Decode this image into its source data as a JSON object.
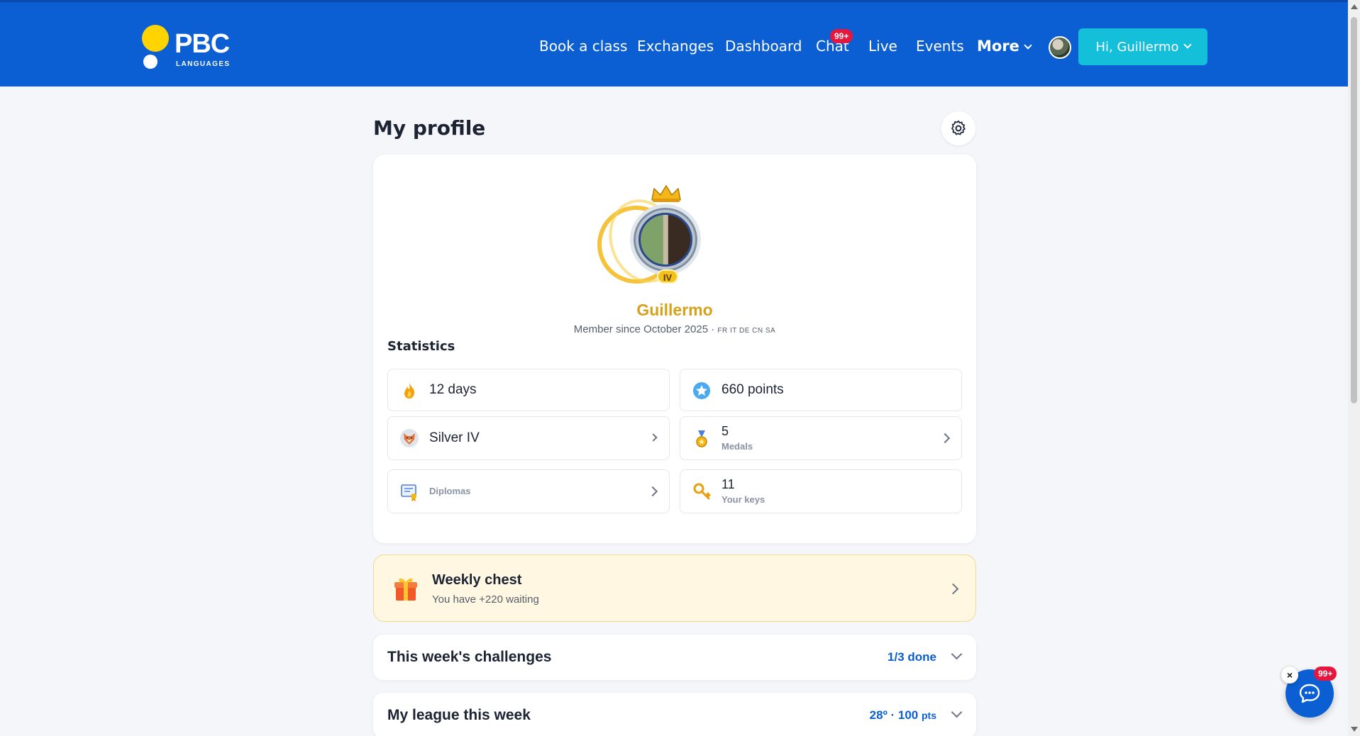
{
  "brand": {
    "name": "PBC",
    "subtitle": "LANGUAGES"
  },
  "nav": {
    "book": "Book a class",
    "exchanges": "Exchanges",
    "dashboard": "Dashboard",
    "chat": "Chat",
    "chat_badge": "99+",
    "live": "Live",
    "events": "Events",
    "more": "More"
  },
  "user_menu": {
    "label": "Hi, Guillermo"
  },
  "page": {
    "title": "My profile"
  },
  "profile": {
    "tier_badge": "IV",
    "name": "Guillermo",
    "member_since": "Member since October 2025 ·",
    "languages": "FR IT DE CN SA"
  },
  "stats": {
    "heading": "Statistics",
    "streak": "12 days",
    "points": "660 points",
    "league": "Silver IV",
    "medals_value": "5",
    "medals_label": "Medals",
    "diplomas_label": "Diplomas",
    "keys_value": "11",
    "keys_label": "Your keys"
  },
  "chest": {
    "title": "Weekly chest",
    "subtitle": "You have +220 waiting"
  },
  "challenges": {
    "title": "This week's challenges",
    "status": "1/3 done"
  },
  "league_week": {
    "title": "My league this week",
    "rank": "28º · 100",
    "unit": "pts"
  },
  "chat_widget": {
    "badge": "99+",
    "close": "×"
  },
  "colors": {
    "header": "#0b5fd3",
    "accent": "#13bfd9",
    "gold": "#d6a21c",
    "badge": "#e5173f"
  }
}
